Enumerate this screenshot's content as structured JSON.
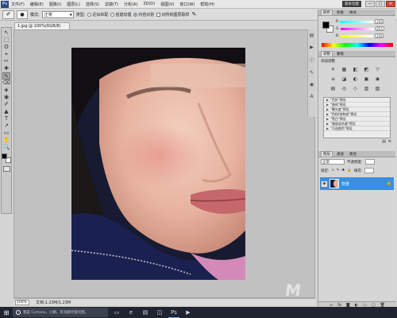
{
  "app": {
    "logo": "Ps"
  },
  "menu": {
    "items": [
      "文件(F)",
      "编辑(E)",
      "图像(I)",
      "图层(L)",
      "选择(S)",
      "滤镜(T)",
      "分析(A)",
      "3D(D)",
      "视图(V)",
      "窗口(W)",
      "帮助(H)"
    ]
  },
  "window": {
    "workspace_label": "基本功能",
    "minimize": "—",
    "maximize": "□",
    "close": "✕"
  },
  "options": {
    "mode_label": "模式:",
    "mode_value": "正常",
    "type_label": "类型:",
    "type_option1": "近似匹配",
    "type_option2": "创建纹理",
    "type_option3": "内容识别",
    "sample_all": "对所有图层取样"
  },
  "document": {
    "tab_title": "1.jpg @ 100%(RGB/8)",
    "zoom": "100%",
    "doc_info": "文档:1.23M/1.23M"
  },
  "panels": {
    "color_tab": "颜色",
    "swatches_tab": "色板",
    "styles_tab": "样式",
    "rgb": [
      {
        "label": "R",
        "value": "255"
      },
      {
        "label": "G",
        "value": "255"
      },
      {
        "label": "B",
        "value": "255"
      }
    ],
    "adjust_tab": "调整",
    "mask_tab": "蒙版",
    "adjust_title": "添加调整",
    "adjust_icons": [
      "☀",
      "▦",
      "◧",
      "◩",
      "▽",
      "≡",
      "◪",
      "◐",
      "▣",
      "◉",
      "▤",
      "◎",
      "◇",
      "▥",
      "▧"
    ],
    "presets": [
      "\"色阶\"预设",
      "\"曲线\"预设",
      "\"曝光度\"预设",
      "\"色相/饱和度\"预设",
      "\"黑白\"预设",
      "\"通道混合器\"预设",
      "\"可选颜色\"预设"
    ],
    "layers_tab": "图层",
    "channels_tab": "通道",
    "paths_tab": "路径",
    "blend_mode": "正常",
    "opacity_label": "不透明度:",
    "lock_label": "锁定:",
    "fill_label": "填充:",
    "layer_name": "背景"
  },
  "taskbar": {
    "search_placeholder": "我是 Cortana，小娜。有问题尽管问我。",
    "apps": [
      "edge",
      "explorer",
      "store",
      "photoshop",
      "media"
    ]
  },
  "icons": {
    "tools": [
      "↖",
      "⬚",
      "ʘ",
      "⌖",
      "✂",
      "✚",
      "✎",
      "⌫",
      "◈",
      "◉",
      "✐",
      "▲",
      "T",
      "↗",
      "▭",
      "✋",
      "🔍"
    ]
  }
}
